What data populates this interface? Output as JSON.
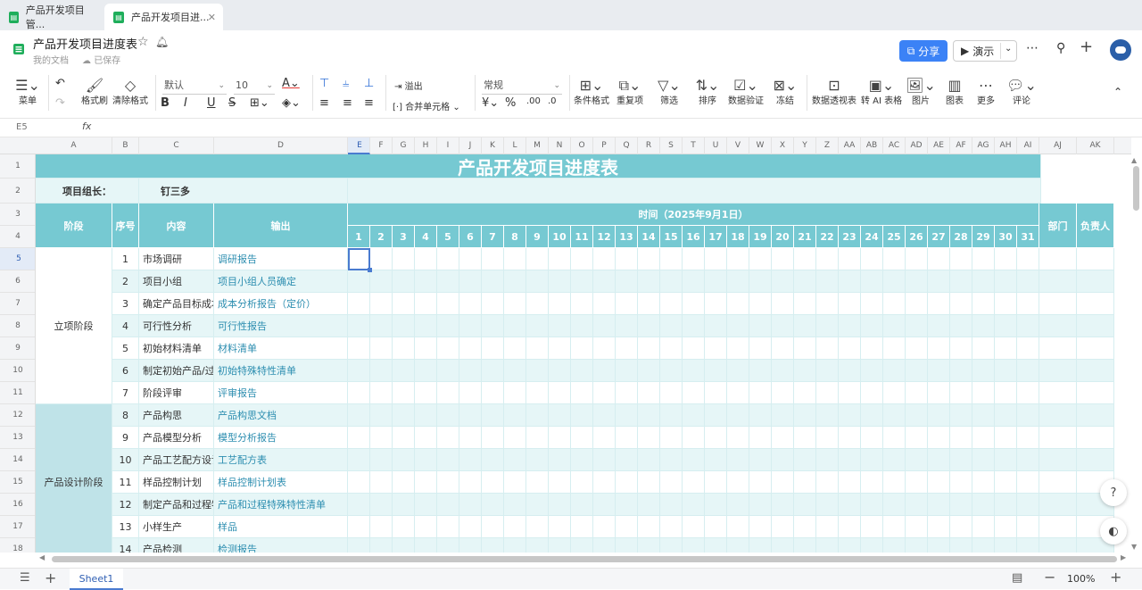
{
  "tabs": [
    {
      "label": "产品开发项目管..."
    },
    {
      "label": "产品开发项目进..."
    }
  ],
  "doc": {
    "title": "产品开发项目进度表",
    "location": "我的文档",
    "saved": "已保存"
  },
  "header": {
    "share": "分享",
    "present": "演示"
  },
  "toolbar": {
    "menu": "菜单",
    "format_painter": "格式刷",
    "clear_format": "清除格式",
    "font": "默认",
    "size": "10",
    "overflow": "溢出",
    "merge": "合并单元格",
    "number_format": "常规",
    "conditional": "条件格式",
    "repeat": "重复项",
    "filter": "筛选",
    "sort": "排序",
    "validate": "数据验证",
    "freeze": "冻结",
    "pivot": "数据透视表",
    "ai_table": "转 AI 表格",
    "image": "图片",
    "chart": "图表",
    "more": "更多",
    "comment": "评论"
  },
  "formula_bar": {
    "cell_ref": "E5",
    "fx": "fx"
  },
  "columns": [
    "A",
    "B",
    "C",
    "D",
    "E",
    "F",
    "G",
    "H",
    "I",
    "J",
    "K",
    "L",
    "M",
    "N",
    "O",
    "P",
    "Q",
    "R",
    "S",
    "T",
    "U",
    "V",
    "W",
    "X",
    "Y",
    "Z",
    "AA",
    "AB",
    "AC",
    "AD",
    "AE",
    "AF",
    "AG",
    "AH",
    "AI",
    "AJ",
    "AK"
  ],
  "rows": [
    "1",
    "2",
    "3",
    "4",
    "5",
    "6",
    "7",
    "8",
    "9",
    "10",
    "11",
    "12",
    "13",
    "14",
    "15",
    "16",
    "17",
    "18"
  ],
  "sheet": {
    "title": "产品开发项目进度表",
    "leader_label": "项目组长：",
    "leader_name": "钉三多",
    "headers": {
      "stage": "阶段",
      "no": "序号",
      "content": "内容",
      "output": "输出",
      "time": "时间（2025年9月1日）",
      "dept": "部门",
      "owner": "负责人"
    },
    "days": [
      "1",
      "2",
      "3",
      "4",
      "5",
      "6",
      "7",
      "8",
      "9",
      "10",
      "11",
      "12",
      "13",
      "14",
      "15",
      "16",
      "17",
      "18",
      "19",
      "20",
      "21",
      "22",
      "23",
      "24",
      "25",
      "26",
      "27",
      "28",
      "29",
      "30",
      "31"
    ],
    "stages": [
      {
        "name": "立项阶段"
      },
      {
        "name": "产品设计阶段"
      }
    ],
    "items": [
      {
        "no": "1",
        "content": "市场调研",
        "output": "调研报告"
      },
      {
        "no": "2",
        "content": "项目小组",
        "output": "项目小组人员确定"
      },
      {
        "no": "3",
        "content": "确定产品目标成本",
        "output": "成本分析报告（定价）"
      },
      {
        "no": "4",
        "content": "可行性分析",
        "output": "可行性报告"
      },
      {
        "no": "5",
        "content": "初始材料清单",
        "output": "材料清单"
      },
      {
        "no": "6",
        "content": "制定初始产品/过程",
        "output": "初始特殊特性清单"
      },
      {
        "no": "7",
        "content": "阶段评审",
        "output": "评审报告"
      },
      {
        "no": "8",
        "content": "产品构思",
        "output": "产品构思文档"
      },
      {
        "no": "9",
        "content": "产品模型分析",
        "output": "模型分析报告"
      },
      {
        "no": "10",
        "content": "产品工艺配方设计",
        "output": "工艺配方表"
      },
      {
        "no": "11",
        "content": "样品控制计划",
        "output": "样品控制计划表"
      },
      {
        "no": "12",
        "content": "制定产品和过程特殊",
        "output": "产品和过程特殊特性清单"
      },
      {
        "no": "13",
        "content": "小样生产",
        "output": "样品"
      },
      {
        "no": "14",
        "content": "产品检测",
        "output": "检测报告"
      }
    ]
  },
  "statusbar": {
    "sheet": "Sheet1",
    "zoom": "100%"
  },
  "colors": {
    "header": "#76c9d2",
    "band_light": "#e6f6f7",
    "stage2": "#bfe3e8",
    "output_text": "#2d8eb0",
    "accent": "#3b82f6"
  }
}
